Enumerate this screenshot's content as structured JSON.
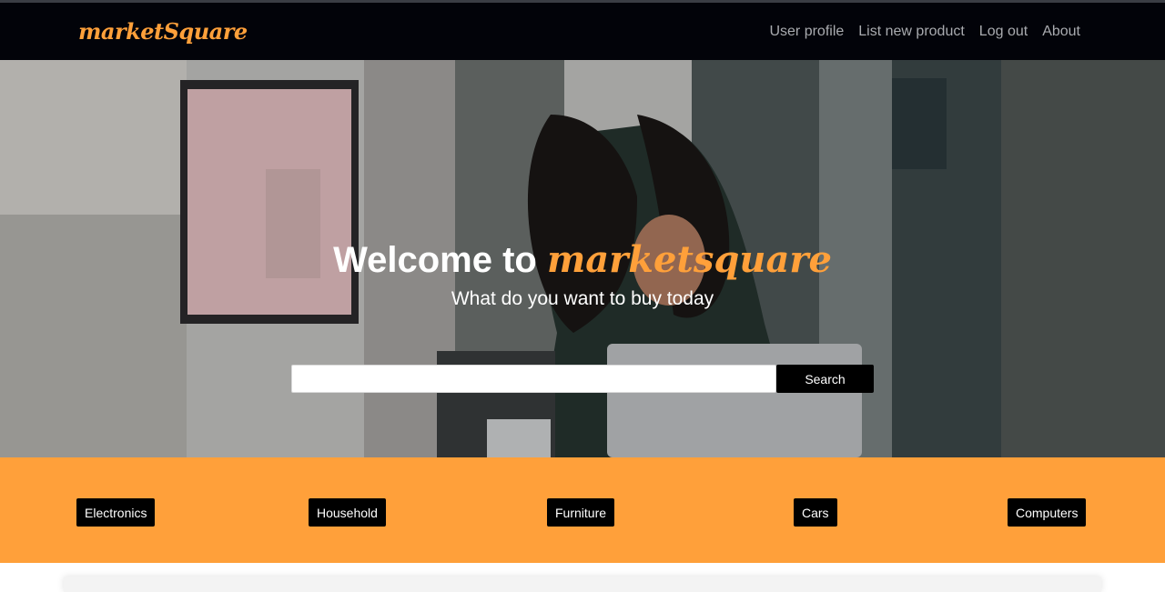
{
  "navbar": {
    "brand": "marketSquare",
    "links": [
      "User profile",
      "List new product",
      "Log out",
      "About"
    ]
  },
  "hero": {
    "title_prefix": "Welcome to ",
    "title_accent": "marketsquare",
    "subtitle": "What do you want to buy today",
    "search_value": "",
    "search_button": "Search"
  },
  "categories": [
    "Electronics",
    "Household",
    "Furniture",
    "Cars",
    "Computers"
  ],
  "colors": {
    "accent": "#ffa03a",
    "navbar": "#020309",
    "button": "#000000"
  }
}
